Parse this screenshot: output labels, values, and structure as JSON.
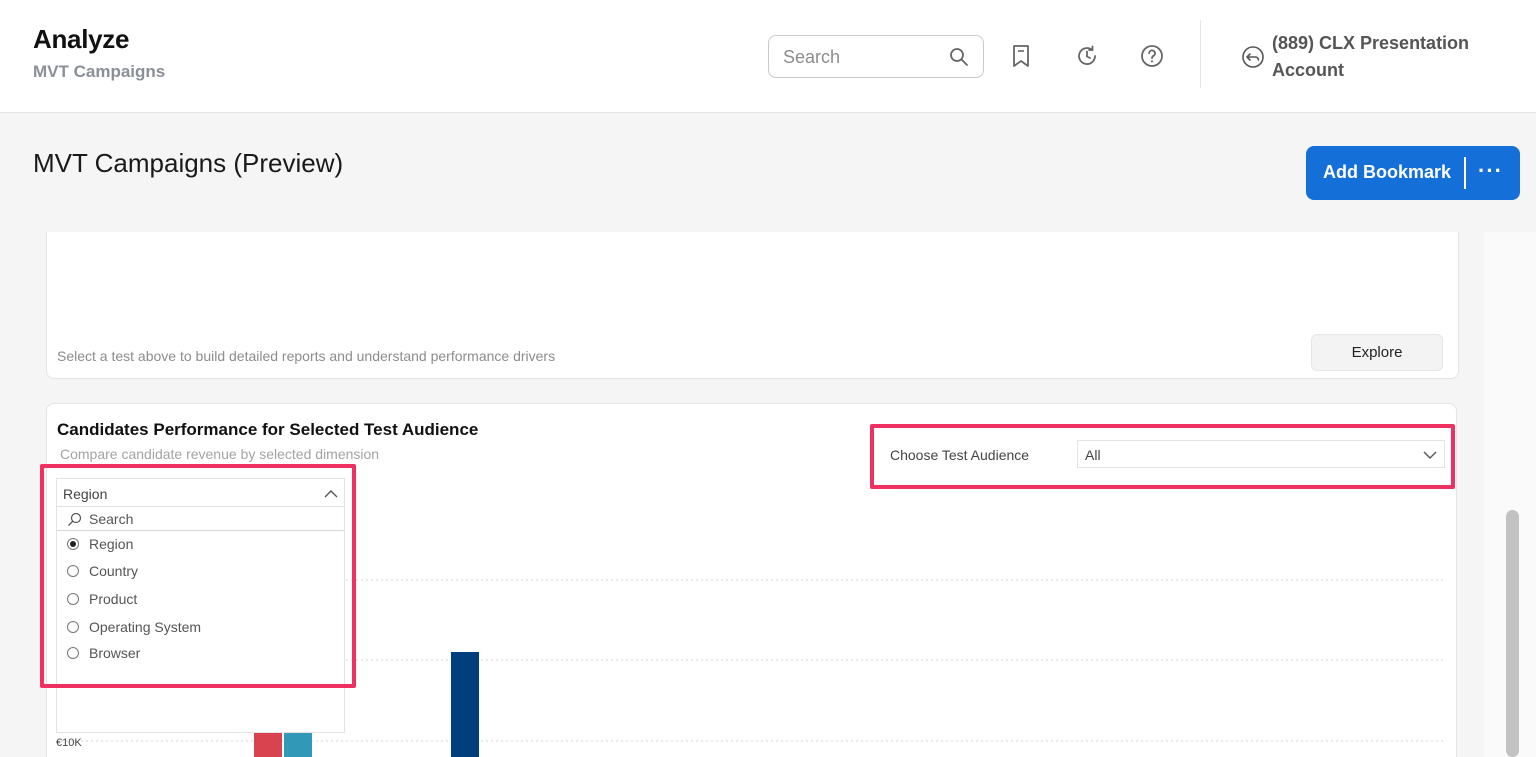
{
  "header": {
    "title": "Analyze",
    "subtitle": "MVT Campaigns",
    "search_placeholder": "Search",
    "account": "(889) CLX Presentation Account"
  },
  "page": {
    "title": "MVT Campaigns (Preview)",
    "add_bookmark_label": "Add Bookmark",
    "more_label": "···"
  },
  "colors": {
    "accent_blue": "#1470d8",
    "highlight": "#ee3160"
  },
  "test_card": {
    "hint": "Select a test above to build detailed reports and understand performance drivers",
    "explore_label": "Explore"
  },
  "candidates_card": {
    "title": "Candidates Performance for Selected Test Audience",
    "subtitle": "Compare candidate revenue by selected dimension",
    "audience_label": "Choose Test Audience",
    "audience_value": "All"
  },
  "dimension_dropdown": {
    "selected": "Region",
    "search_placeholder": "Search",
    "options": [
      {
        "label": "Region",
        "checked": true
      },
      {
        "label": "Country",
        "checked": false
      },
      {
        "label": "Product",
        "checked": false
      },
      {
        "label": "Operating System",
        "checked": false
      },
      {
        "label": "Browser",
        "checked": false
      }
    ]
  },
  "chart_data": {
    "type": "bar",
    "y_tick_labels": [
      "€10K"
    ],
    "bar_colors": [
      "#d9434f",
      "#3198b8",
      "#003f7d"
    ],
    "grid": true
  }
}
